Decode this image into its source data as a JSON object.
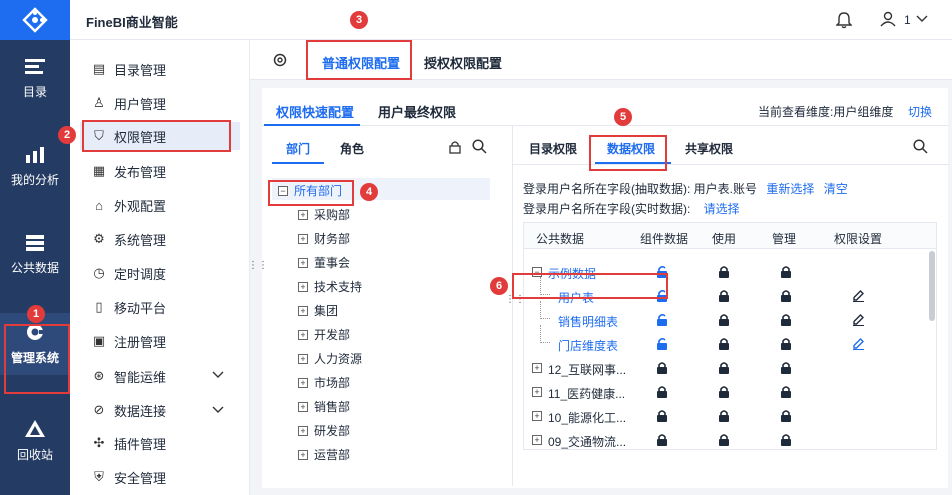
{
  "app": {
    "title": "FineBI商业智能",
    "user_label": "1"
  },
  "leftnav": [
    {
      "label": "目录",
      "icon": "catalog-icon"
    },
    {
      "label": "我的分析",
      "icon": "analysis-icon"
    },
    {
      "label": "公共数据",
      "icon": "public-data-icon"
    },
    {
      "label": "管理系统",
      "icon": "gear-icon"
    },
    {
      "label": "回收站",
      "icon": "recycle-icon"
    }
  ],
  "sidebar": {
    "items": [
      {
        "label": "目录管理",
        "icon": "list-icon"
      },
      {
        "label": "用户管理",
        "icon": "user-icon"
      },
      {
        "label": "权限管理",
        "icon": "shield-icon"
      },
      {
        "label": "发布管理",
        "icon": "publish-icon"
      },
      {
        "label": "外观配置",
        "icon": "appearance-icon"
      },
      {
        "label": "系统管理",
        "icon": "settings-icon"
      },
      {
        "label": "定时调度",
        "icon": "timer-icon"
      },
      {
        "label": "移动平台",
        "icon": "mobile-icon"
      },
      {
        "label": "注册管理",
        "icon": "register-icon"
      },
      {
        "label": "智能运维",
        "icon": "ops-icon"
      },
      {
        "label": "数据连接",
        "icon": "link-icon"
      },
      {
        "label": "插件管理",
        "icon": "plugin-icon"
      },
      {
        "label": "安全管理",
        "icon": "security-icon"
      }
    ]
  },
  "tabs1": [
    "普通权限配置",
    "授权权限配置"
  ],
  "tabs2": [
    "权限快速配置",
    "用户最终权限"
  ],
  "view_dim": "当前查看维度:用户组维度",
  "switch_label": "切换",
  "lefttabs": [
    "部门",
    "角色"
  ],
  "tree": {
    "root": "所有部门",
    "children": [
      "采购部",
      "财务部",
      "董事会",
      "技术支持",
      "集团",
      "开发部",
      "人力资源",
      "市场部",
      "销售部",
      "研发部",
      "运营部"
    ]
  },
  "righttabs": [
    "目录权限",
    "数据权限",
    "共享权限"
  ],
  "field1": {
    "label": "登录用户名所在字段(抽取数据):",
    "value": "用户表.账号",
    "reselect": "重新选择",
    "clear": "清空"
  },
  "field2": {
    "label": "登录用户名所在字段(实时数据):",
    "select": "请选择"
  },
  "table": {
    "headers": [
      "公共数据",
      "组件数据",
      "使用",
      "管理",
      "权限设置"
    ],
    "rows": [
      {
        "name": "示例数据",
        "expander": "minus",
        "child": false,
        "edit": false
      },
      {
        "name": "用户表",
        "child": true,
        "edit": true
      },
      {
        "name": "销售明细表",
        "child": true,
        "edit": true
      },
      {
        "name": "门店维度表",
        "child": true,
        "edit": true
      },
      {
        "name": "12_互联网事...",
        "expander": "plus",
        "child": false,
        "edit": false
      },
      {
        "name": "11_医药健康...",
        "expander": "plus",
        "child": false,
        "edit": false
      },
      {
        "name": "10_能源化工...",
        "expander": "plus",
        "child": false,
        "edit": false
      },
      {
        "name": "09_交通物流...",
        "expander": "plus",
        "child": false,
        "edit": false
      }
    ]
  },
  "badges": [
    "1",
    "2",
    "3",
    "4",
    "5",
    "6"
  ],
  "colors": {
    "accent": "#1e6cf0",
    "nav": "#243b63",
    "highlight": "#e23b3b"
  }
}
